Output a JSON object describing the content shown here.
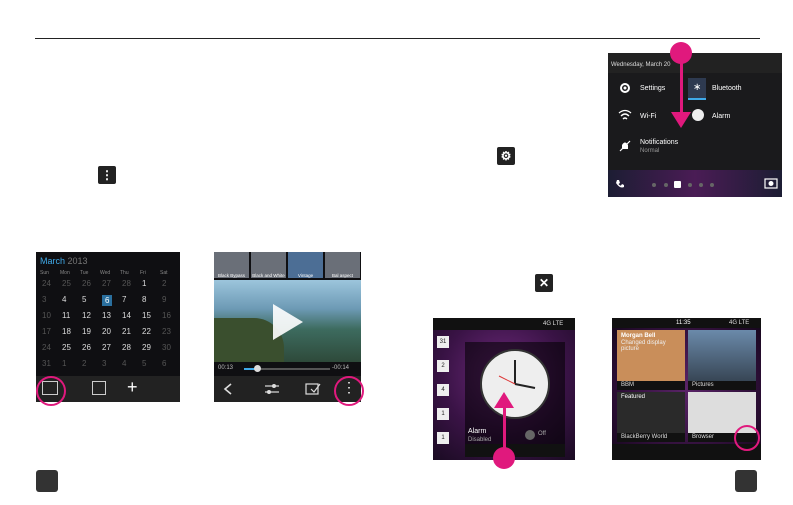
{
  "ui": {
    "inline_icons": {
      "more_glyph": "⋮",
      "settings_glyph": "⚙",
      "close_glyph": "✕"
    }
  },
  "calendar": {
    "month": "March",
    "year": "2013",
    "weekdays": [
      "Sun",
      "Mon",
      "Tue",
      "Wed",
      "Thu",
      "Fri",
      "Sat"
    ],
    "weeks": [
      [
        "24",
        "25",
        "26",
        "27",
        "28",
        "1",
        "2"
      ],
      [
        "3",
        "4",
        "5",
        "6",
        "7",
        "8",
        "9"
      ],
      [
        "10",
        "11",
        "12",
        "13",
        "14",
        "15",
        "16"
      ],
      [
        "17",
        "18",
        "19",
        "20",
        "21",
        "22",
        "23"
      ],
      [
        "24",
        "25",
        "26",
        "27",
        "28",
        "29",
        "30"
      ],
      [
        "31",
        "1",
        "2",
        "3",
        "4",
        "5",
        "6"
      ]
    ],
    "bottom_icons": [
      "calendar-icon",
      "new-contact-icon",
      "add-icon"
    ],
    "add_glyph": "+"
  },
  "video": {
    "filters": [
      "Black Bypass",
      "Black and White",
      "Vintage",
      "Bal aspect"
    ],
    "time_current": "00:13",
    "time_remaining": "-00:14"
  },
  "quick_settings": {
    "date": "Wednesday, March 20",
    "items": [
      {
        "label": "Settings"
      },
      {
        "label": "Bluetooth"
      },
      {
        "label": "Wi-Fi"
      },
      {
        "label": "Alarm"
      }
    ],
    "notifications_label": "Notifications",
    "notifications_sub": "Normal"
  },
  "alarm": {
    "status": "4G LTE",
    "title": "Alarm",
    "sub": "Disabled",
    "toggle": "Off",
    "badges": [
      "31",
      "2",
      "4",
      "1",
      "1"
    ]
  },
  "active_frames": {
    "time": "11:35",
    "status": "4G LTE",
    "tiles": [
      {
        "title": "Morgan Bell",
        "sub": "Changed display picture",
        "label": "BBM"
      },
      {
        "label": "Pictures"
      },
      {
        "title": "Featured",
        "label": "BlackBerry World"
      },
      {
        "label": "Browser"
      }
    ]
  }
}
